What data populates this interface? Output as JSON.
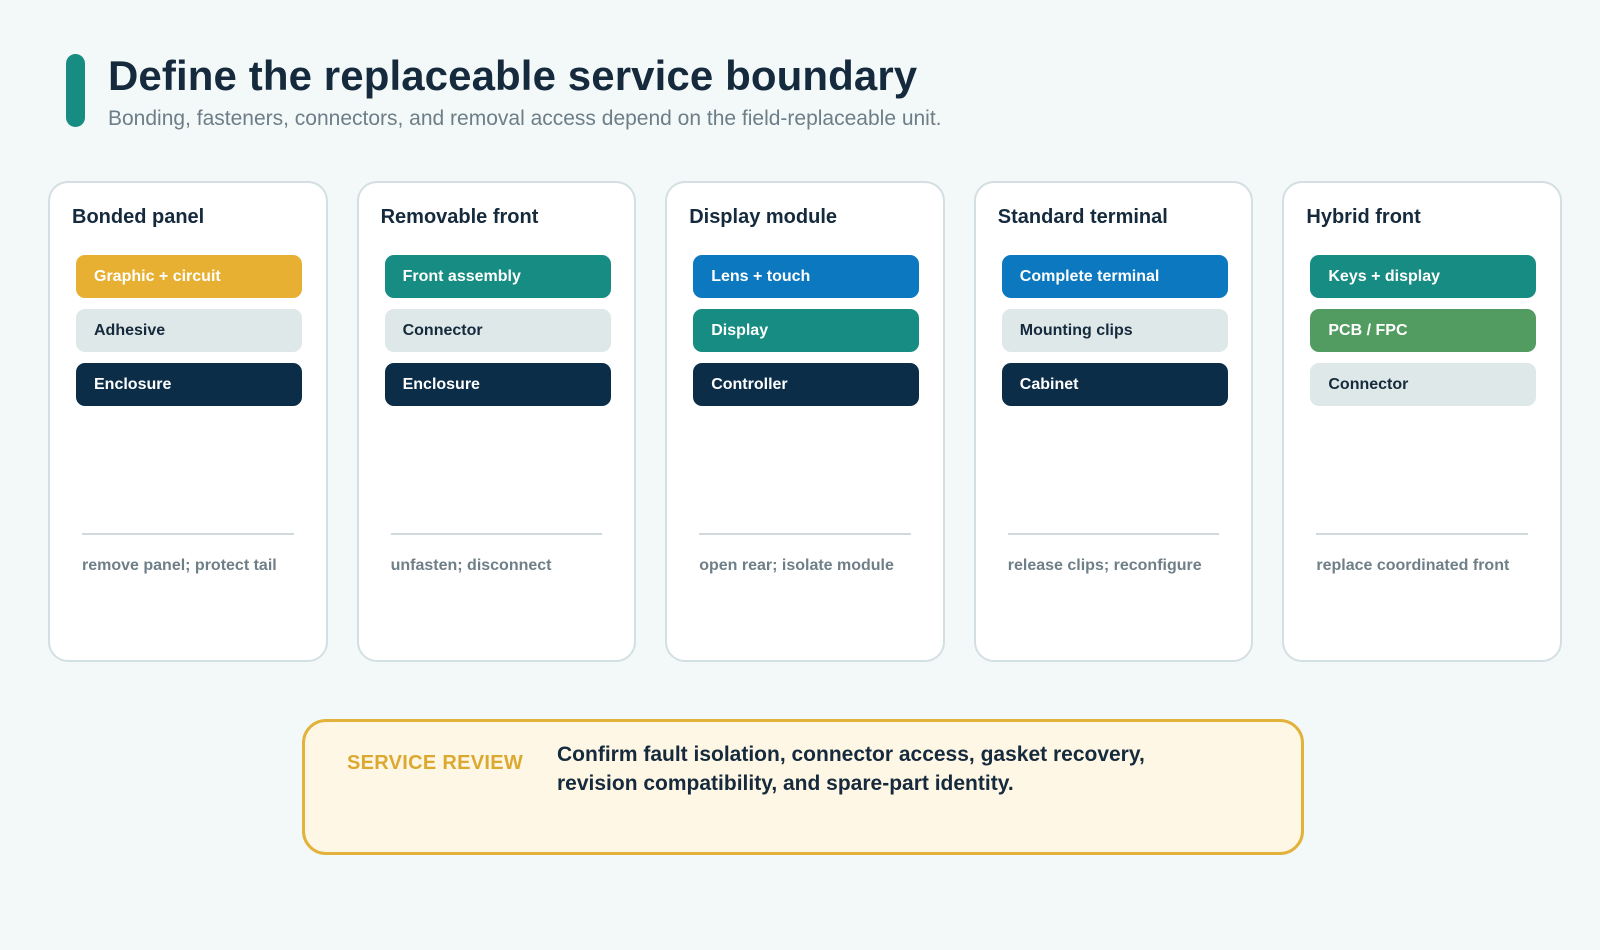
{
  "header": {
    "title": "Define the replaceable service boundary",
    "subtitle": "Bonding, fasteners, connectors, and removal access depend on the field-replaceable unit."
  },
  "colors": {
    "amber": "#e7b032",
    "teal": "#178c82",
    "blue": "#0c78bf",
    "navy": "#0b2d48",
    "light": "#dfe8e8",
    "green": "#539c61"
  },
  "cards": [
    {
      "title": "Bonded panel",
      "layers": [
        {
          "label": "Graphic + circuit",
          "color": "#e7b032",
          "text_color": "#ffffff"
        },
        {
          "label": "Adhesive",
          "color": "#dfe8e8",
          "text_color": "#152a3c"
        },
        {
          "label": "Enclosure",
          "color": "#0b2d48",
          "text_color": "#ffffff"
        }
      ],
      "note": "remove panel; protect tail"
    },
    {
      "title": "Removable front",
      "layers": [
        {
          "label": "Front assembly",
          "color": "#178c82",
          "text_color": "#ffffff"
        },
        {
          "label": "Connector",
          "color": "#dfe8e8",
          "text_color": "#152a3c"
        },
        {
          "label": "Enclosure",
          "color": "#0b2d48",
          "text_color": "#ffffff"
        }
      ],
      "note": "unfasten; disconnect"
    },
    {
      "title": "Display module",
      "layers": [
        {
          "label": "Lens + touch",
          "color": "#0c78bf",
          "text_color": "#ffffff"
        },
        {
          "label": "Display",
          "color": "#178c82",
          "text_color": "#ffffff"
        },
        {
          "label": "Controller",
          "color": "#0b2d48",
          "text_color": "#ffffff"
        }
      ],
      "note": "open rear; isolate module"
    },
    {
      "title": "Standard terminal",
      "layers": [
        {
          "label": "Complete terminal",
          "color": "#0c78bf",
          "text_color": "#ffffff"
        },
        {
          "label": "Mounting clips",
          "color": "#dfe8e8",
          "text_color": "#152a3c"
        },
        {
          "label": "Cabinet",
          "color": "#0b2d48",
          "text_color": "#ffffff"
        }
      ],
      "note": "release clips; reconfigure"
    },
    {
      "title": "Hybrid front",
      "layers": [
        {
          "label": "Keys + display",
          "color": "#178c82",
          "text_color": "#ffffff"
        },
        {
          "label": "PCB / FPC",
          "color": "#539c61",
          "text_color": "#ffffff"
        },
        {
          "label": "Connector",
          "color": "#dfe8e8",
          "text_color": "#152a3c"
        }
      ],
      "note": "replace coordinated front"
    }
  ],
  "review": {
    "label": "SERVICE REVIEW",
    "text": "Confirm fault isolation, connector access, gasket recovery, revision compatibility, and spare-part identity."
  }
}
